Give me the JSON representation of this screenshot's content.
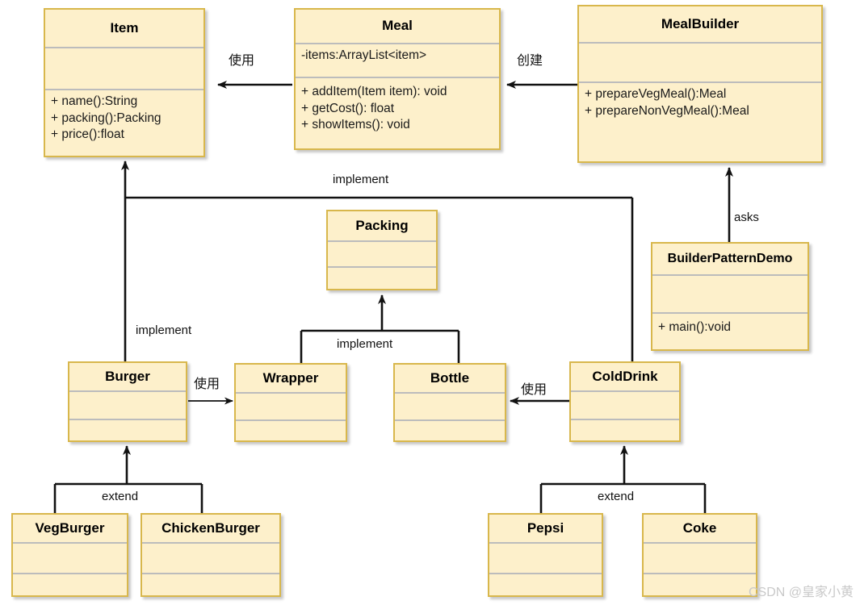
{
  "diagram": {
    "title": "Builder Pattern UML Class Diagram",
    "colors": {
      "box_fill": "#fdf0cb",
      "box_border": "#d8b74c",
      "separator": "#bcbcbc",
      "edge": "#111111",
      "watermark": "#c9c9c9"
    }
  },
  "classes": {
    "item": {
      "name": "Item",
      "attributes": [],
      "methods": [
        "+ name():String",
        "+ packing():Packing",
        "+ price():float"
      ]
    },
    "meal": {
      "name": "Meal",
      "attributes": [
        "-items:ArrayList<item>"
      ],
      "methods": [
        "+ addItem(Item item): void",
        "+ getCost(): float",
        "+ showItems(): void"
      ]
    },
    "mealbuilder": {
      "name": "MealBuilder",
      "attributes": [],
      "methods": [
        "+ prepareVegMeal():Meal",
        "+ prepareNonVegMeal():Meal"
      ]
    },
    "builderpatterndemo": {
      "name": "BuilderPatternDemo",
      "attributes": [],
      "methods": [
        "+ main():void"
      ]
    },
    "packing": {
      "name": "Packing",
      "attributes": [],
      "methods": []
    },
    "burger": {
      "name": "Burger",
      "attributes": [],
      "methods": []
    },
    "wrapper": {
      "name": "Wrapper",
      "attributes": [],
      "methods": []
    },
    "bottle": {
      "name": "Bottle",
      "attributes": [],
      "methods": []
    },
    "colddrink": {
      "name": "ColdDrink",
      "attributes": [],
      "methods": []
    },
    "vegburger": {
      "name": "VegBurger",
      "attributes": [],
      "methods": []
    },
    "chickenburger": {
      "name": "ChickenBurger",
      "attributes": [],
      "methods": []
    },
    "pepsi": {
      "name": "Pepsi",
      "attributes": [],
      "methods": []
    },
    "coke": {
      "name": "Coke",
      "attributes": [],
      "methods": []
    }
  },
  "relations": {
    "meal_uses_item": "使用",
    "mealbuilder_creates_meal": "创建",
    "demo_asks_mealbuilder": "asks",
    "items_implement": "implement",
    "burger_implement": "implement",
    "packing_implement": "implement",
    "burger_uses_wrapper": "使用",
    "colddrink_uses_bottle": "使用",
    "burger_extend": "extend",
    "colddrink_extend": "extend"
  },
  "watermark": {
    "text": "CSDN @皇家小黄"
  }
}
